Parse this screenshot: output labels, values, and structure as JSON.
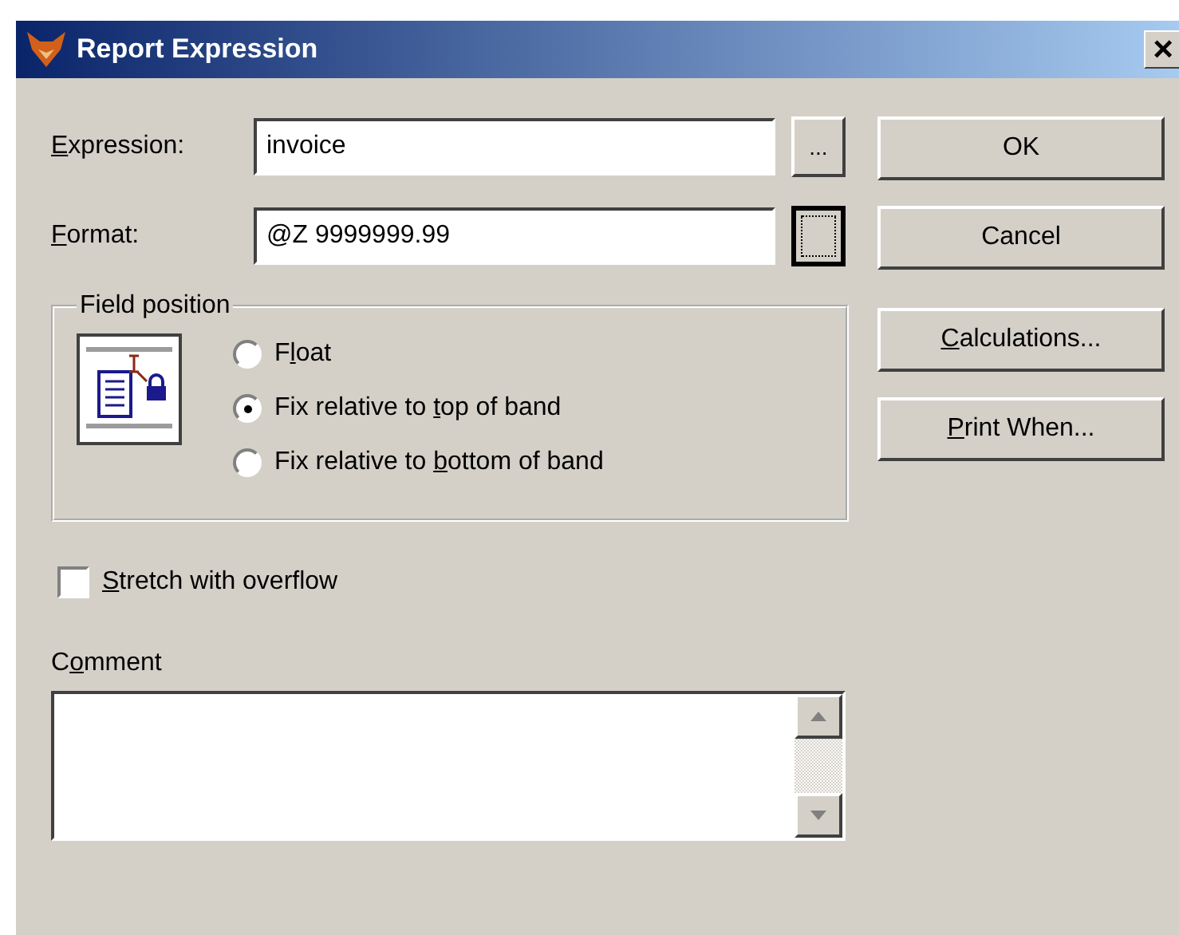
{
  "window": {
    "title": "Report Expression",
    "close": "×"
  },
  "fields": [
    {
      "label": {
        "key": "E",
        "post": "xpression:"
      },
      "value": "invoice",
      "button_label": "...",
      "focused": false
    },
    {
      "label": {
        "key": "F",
        "post": "ormat:"
      },
      "value": "@Z 9999999.99",
      "focused": true
    }
  ],
  "buttons": [
    {
      "label": {
        "pre": "OK"
      }
    },
    {
      "label": {
        "pre": "Cancel"
      }
    },
    {
      "label": {
        "key": "C",
        "post": "alculations..."
      }
    },
    {
      "label": {
        "key": "P",
        "post": "rint When..."
      }
    }
  ],
  "field_position": {
    "title": "Field position",
    "options": [
      {
        "label": {
          "pre": "F",
          "key": "l",
          "post": "oat"
        },
        "selected": false
      },
      {
        "label": {
          "pre": "Fix relative to ",
          "key": "t",
          "post": "op of band"
        },
        "selected": true
      },
      {
        "label": {
          "pre": "Fix relative to ",
          "key": "b",
          "post": "ottom of band"
        },
        "selected": false
      }
    ]
  },
  "stretch": {
    "label": {
      "key": "S",
      "post": "tretch with overflow"
    },
    "checked": false
  },
  "comment": {
    "label": {
      "pre": "C",
      "key": "o",
      "post": "mment"
    }
  }
}
